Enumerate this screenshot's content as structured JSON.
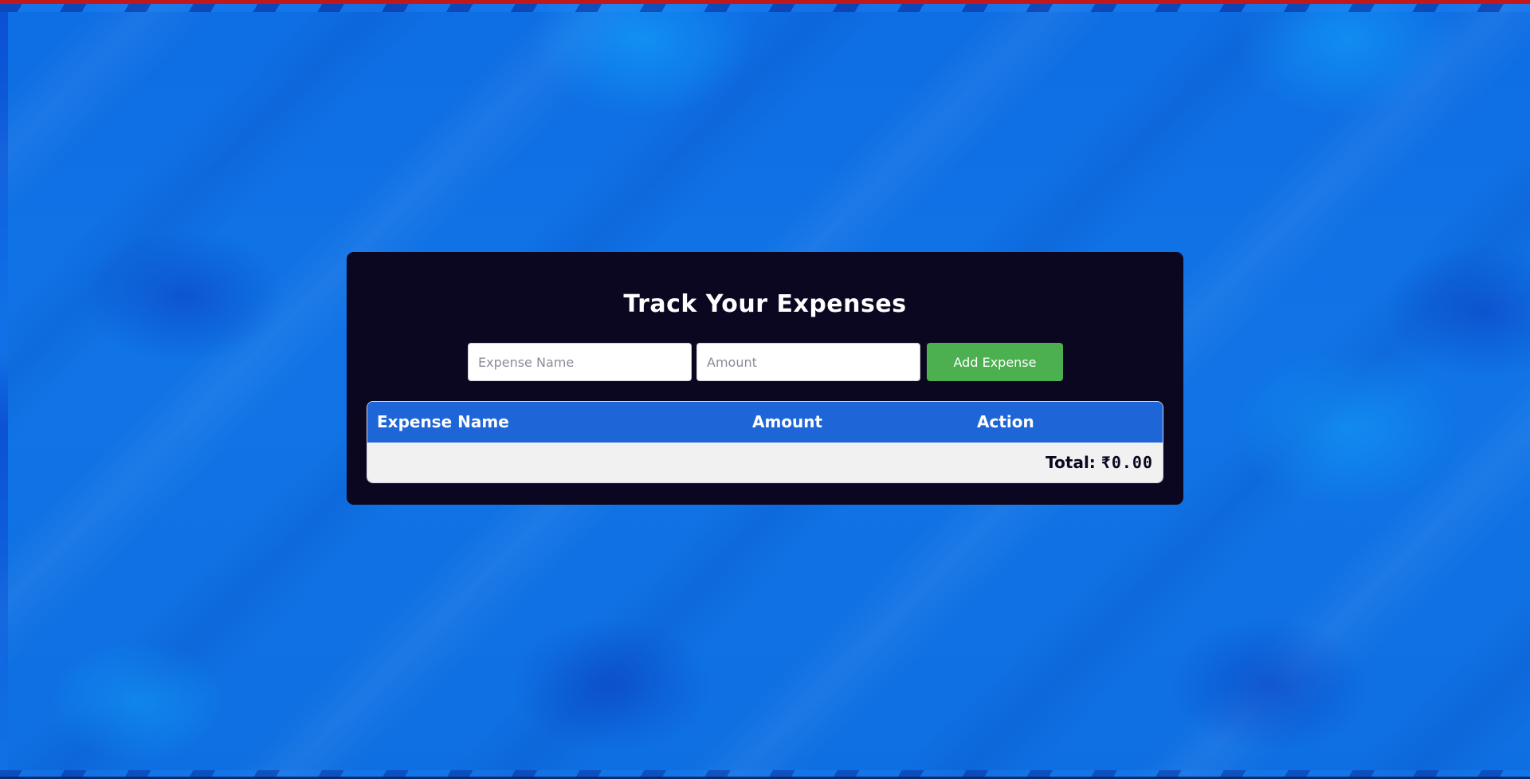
{
  "app": {
    "title": "Track Your Expenses"
  },
  "form": {
    "name_placeholder": "Expense Name",
    "name_value": "",
    "amount_placeholder": "Amount",
    "amount_value": "",
    "add_label": "Add Expense"
  },
  "table": {
    "columns": [
      "Expense Name",
      "Amount",
      "Action"
    ],
    "rows": [],
    "total_label": "Total:",
    "total_value": "₹0.00"
  },
  "colors": {
    "card_bg": "#0b0720",
    "header_bg": "#1e65d8",
    "button_bg": "#4caf50",
    "footer_bg": "#f1f1f1",
    "page_bg": "#0f6fe0",
    "top_bar": "#c0181b"
  }
}
